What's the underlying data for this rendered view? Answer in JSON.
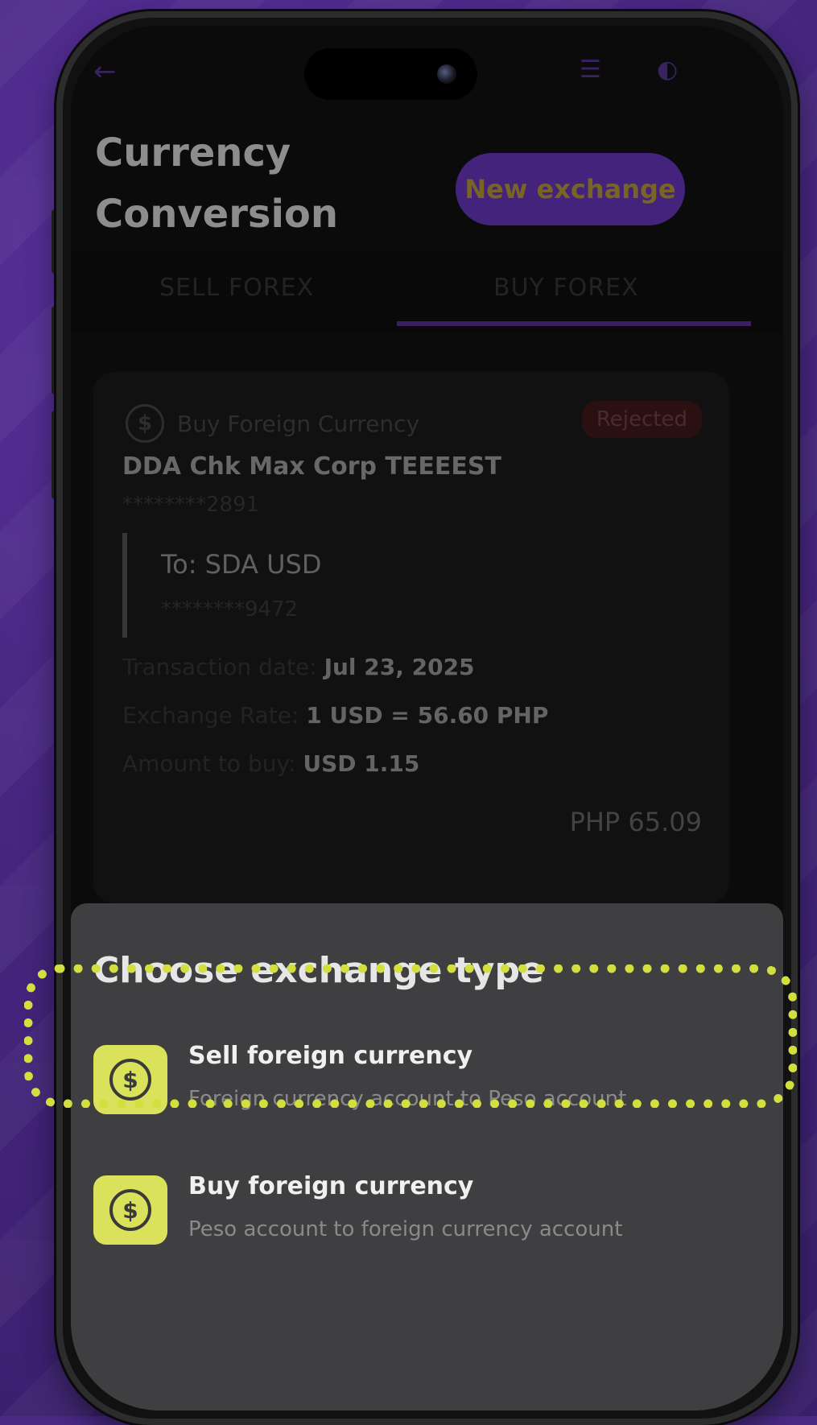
{
  "header": {
    "title_line1": "Currency",
    "title_line2": "Conversion",
    "new_exchange_label": "New exchange"
  },
  "tabs": [
    {
      "label": "SELL FOREX",
      "active": false
    },
    {
      "label": "BUY FOREX",
      "active": true
    }
  ],
  "card": {
    "type_label": "Buy Foreign Currency",
    "status": "Rejected",
    "from_account_name": "DDA Chk Max Corp TEEEEST",
    "from_account_number": "********2891",
    "to_label": "To: SDA USD",
    "to_account_number": "********9472",
    "transaction_date_label": "Transaction date:",
    "transaction_date_value": "Jul 23, 2025",
    "exchange_rate_label": "Exchange Rate:",
    "exchange_rate_value": "1 USD = 56.60 PHP",
    "amount_label": "Amount to buy:",
    "amount_value": "USD 1.15",
    "total": "PHP 65.09"
  },
  "sheet": {
    "title": "Choose exchange type",
    "options": [
      {
        "title": "Sell foreign currency",
        "subtitle": "Foreign currency account to Peso account"
      },
      {
        "title": "Buy foreign currency",
        "subtitle": "Peso account to foreign currency account"
      }
    ]
  },
  "colors": {
    "accent_purple": "#5a2fa6",
    "option_icon_yellow": "#d9e25a",
    "highlight_yellow": "#d3df3f",
    "rejected_bg": "#3a1619"
  },
  "icons": {
    "back": "arrow-left-icon",
    "filter": "filter-icon",
    "currency_exchange": "currency-exchange-icon"
  }
}
